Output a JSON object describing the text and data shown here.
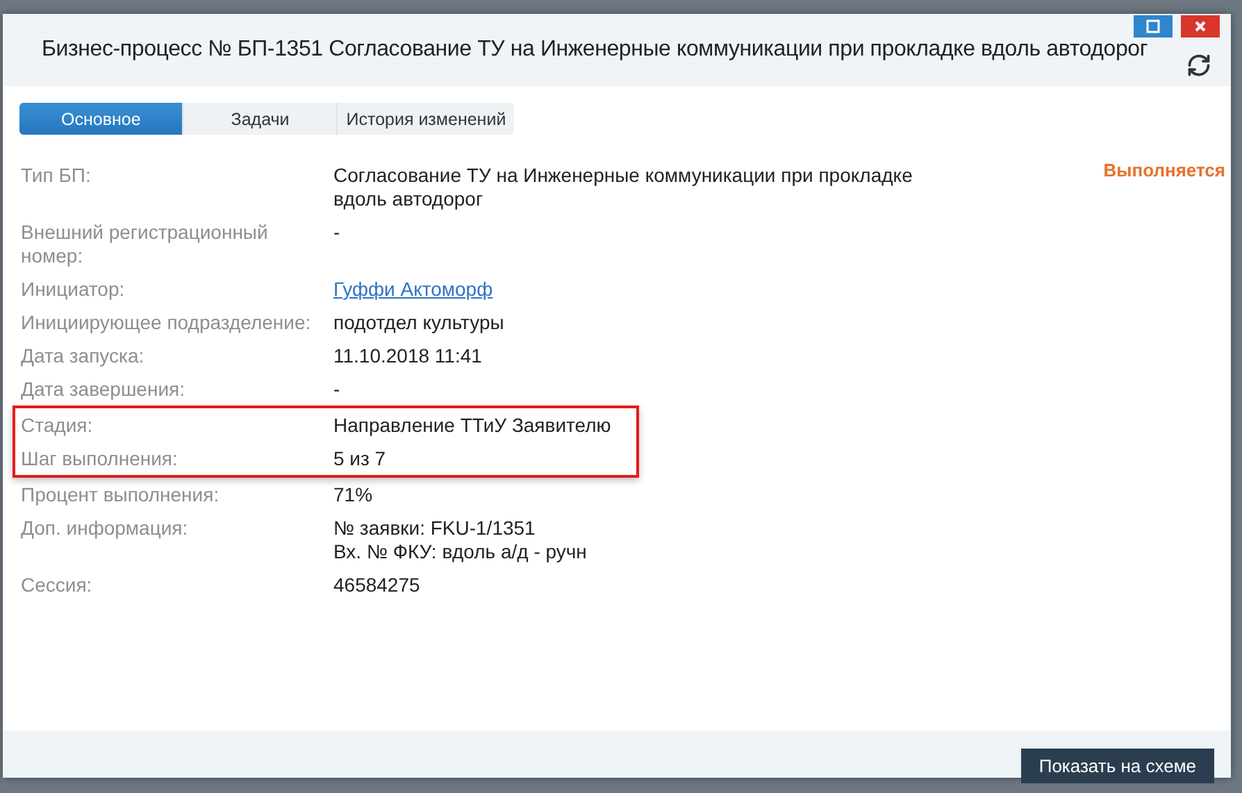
{
  "window": {
    "title": "Бизнес-процесс № БП-1351 Согласование ТУ на Инженерные коммуникации при прокладке вдоль автодорог"
  },
  "tabs": [
    {
      "label": "Основное",
      "selected": true
    },
    {
      "label": "Задачи",
      "selected": false
    },
    {
      "label": "История изменений",
      "selected": false
    }
  ],
  "status": "Выполняется",
  "fields": [
    {
      "label": "Тип БП:",
      "lines": [
        "Согласование ТУ на Инженерные коммуникации при прокладке",
        "вдоль автодорог"
      ],
      "kind": "text",
      "highlighted": false
    },
    {
      "label": "Внешний регистрационный номер:",
      "lines": [
        "-"
      ],
      "kind": "text",
      "highlighted": false
    },
    {
      "label": "Инициатор:",
      "lines": [
        "Гуффи Актоморф"
      ],
      "kind": "link",
      "highlighted": false
    },
    {
      "label": "Инициирующее подразделение:",
      "lines": [
        "подотдел культуры"
      ],
      "kind": "text",
      "highlighted": false
    },
    {
      "label": "Дата запуска:",
      "lines": [
        "11.10.2018 11:41"
      ],
      "kind": "text",
      "highlighted": false
    },
    {
      "label": "Дата завершения:",
      "lines": [
        "-"
      ],
      "kind": "text",
      "highlighted": false
    },
    {
      "label": "Стадия:",
      "lines": [
        "Направление ТТиУ Заявителю"
      ],
      "kind": "text",
      "highlighted": true
    },
    {
      "label": "Шаг выполнения:",
      "lines": [
        "5 из 7"
      ],
      "kind": "text",
      "highlighted": true
    },
    {
      "label": "Процент выполнения:",
      "lines": [
        "71%"
      ],
      "kind": "text",
      "highlighted": false
    },
    {
      "label": "Доп. информация:",
      "lines": [
        "№ заявки: FKU-1/1351",
        "Вх. № ФКУ: вдоль а/д - ручн"
      ],
      "kind": "text",
      "highlighted": false
    },
    {
      "label": "Сессия:",
      "lines": [
        "46584275"
      ],
      "kind": "text",
      "highlighted": false
    }
  ],
  "footer_button": "Показать на схеме"
}
